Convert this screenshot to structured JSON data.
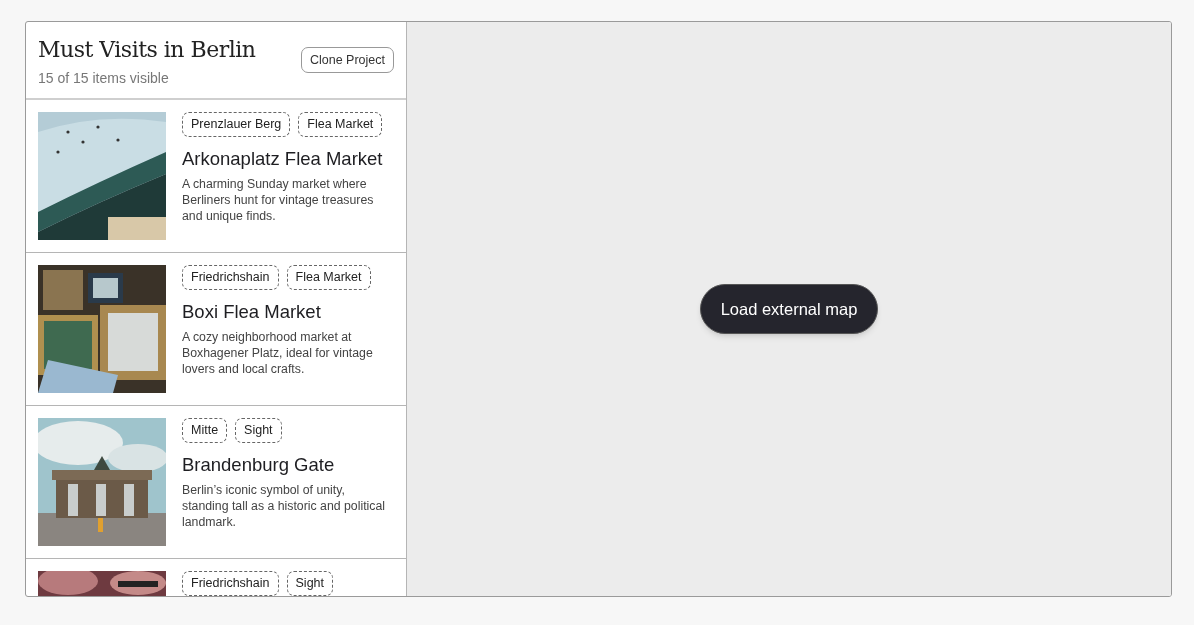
{
  "project": {
    "title": "Must Visits in Berlin",
    "subtitle": "15 of 15 items visible",
    "clone_button": "Clone Project"
  },
  "items": [
    {
      "tags": [
        "Prenzlauer Berg",
        "Flea Market"
      ],
      "title": "Arkonaplatz Flea Market",
      "description": "A charming Sunday market where Berliners hunt for vintage treasures and unique finds."
    },
    {
      "tags": [
        "Friedrichshain",
        "Flea Market"
      ],
      "title": "Boxi Flea Market",
      "description": "A cozy neighborhood market at Boxhagener Platz, ideal for vintage lovers and local crafts."
    },
    {
      "tags": [
        "Mitte",
        "Sight"
      ],
      "title": "Brandenburg Gate",
      "description": "Berlin’s iconic symbol of unity, standing tall as a historic and political landmark."
    },
    {
      "tags": [
        "Friedrichshain",
        "Sight"
      ]
    }
  ],
  "map": {
    "button": "Load external map"
  }
}
